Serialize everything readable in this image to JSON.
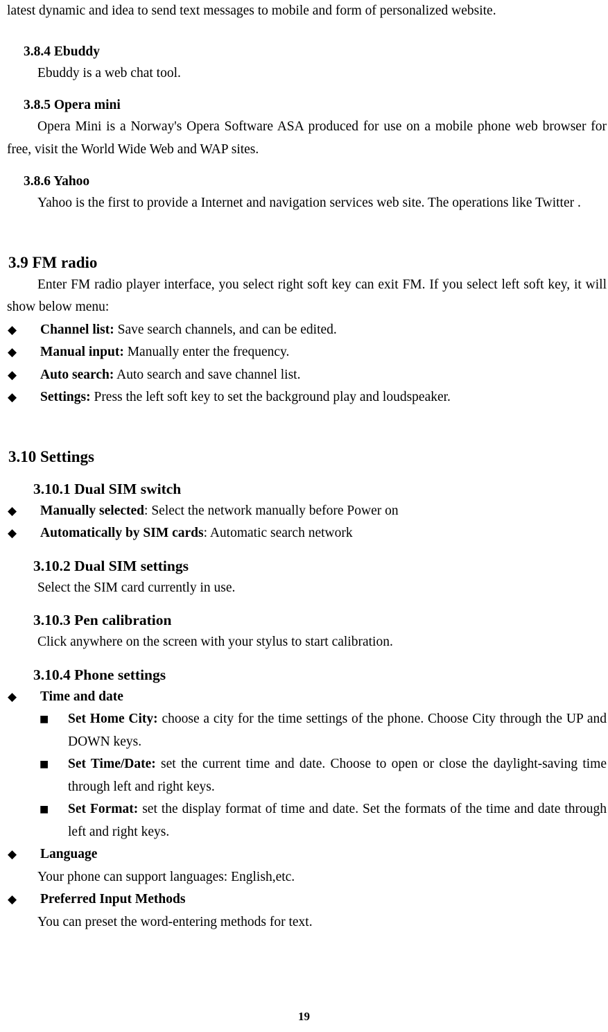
{
  "document": {
    "page_number": "19",
    "bullet_glyphs": {
      "diamond": "◆",
      "square": "■"
    },
    "intro_line": "latest dynamic and idea to send text messages to mobile and form of personalized website.",
    "sections": [
      {
        "id": "3.8.4",
        "heading": "3.8.4 Ebuddy",
        "body": "Ebuddy is a web chat tool."
      },
      {
        "id": "3.8.5",
        "heading": "3.8.5 Opera mini",
        "body": "Opera Mini is a Norway's Opera Software ASA produced for use on a mobile phone web browser for free, visit the World Wide Web and WAP sites."
      },
      {
        "id": "3.8.6",
        "heading": "3.8.6 Yahoo",
        "body": "Yahoo is the first to provide a Internet and navigation services web site. The operations like Twitter ."
      },
      {
        "id": "3.9",
        "heading": "3.9 FM radio",
        "body": "Enter FM radio player interface, you select right soft key can exit FM. If you select left soft key, it will show below menu:",
        "bullets": [
          {
            "label": "Channel list:",
            "text": " Save search channels, and can be edited."
          },
          {
            "label": "Manual input:",
            "text": " Manually enter the frequency."
          },
          {
            "label": "Auto search:",
            "text": " Auto search and save channel list."
          },
          {
            "label": "Settings:",
            "text": " Press the left soft key to set the background play and loudspeaker."
          }
        ]
      },
      {
        "id": "3.10",
        "heading": "3.10 Settings"
      },
      {
        "id": "3.10.1",
        "heading": "3.10.1 Dual SIM switch",
        "bullets": [
          {
            "label": "Manually selected",
            "text": ": Select the network manually before Power on"
          },
          {
            "label": "Automatically by SIM cards",
            "text": ": Automatic search network"
          }
        ]
      },
      {
        "id": "3.10.2",
        "heading": "3.10.2 Dual SIM settings",
        "body": "Select the SIM card currently in use."
      },
      {
        "id": "3.10.3",
        "heading": "3.10.3 Pen calibration",
        "body": "Click anywhere on the screen with your stylus to start calibration."
      },
      {
        "id": "3.10.4",
        "heading": "3.10.4 Phone settings",
        "groups": [
          {
            "label": "Time and date",
            "sub_bullets": [
              {
                "label": "Set Home City:",
                "text": " choose a city for the time settings of the phone. Choose City through the UP and DOWN keys."
              },
              {
                "label": "Set Time/Date:",
                "text": " set the current time and date. Choose to open or close the daylight-saving time through left and right keys."
              },
              {
                "label": "Set Format:",
                "text": " set the display format of time and date. Set the formats of the time and date through left and right keys."
              }
            ]
          },
          {
            "label": "Language",
            "body": "Your phone can support languages: English,etc."
          },
          {
            "label": "Preferred Input Methods",
            "body": "You can preset the word-entering methods for text."
          }
        ]
      }
    ]
  }
}
